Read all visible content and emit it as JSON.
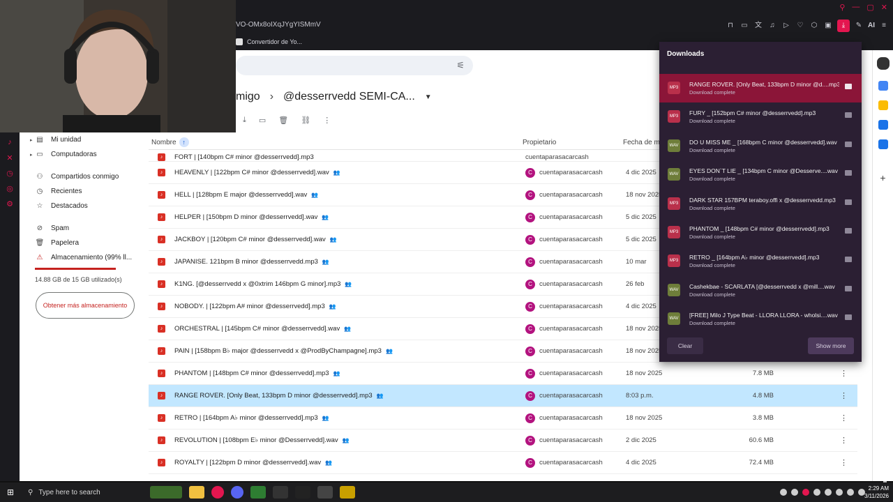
{
  "browser": {
    "address_text": "VO-OMx8oIXqJYgYISMmV",
    "tab_label": "Convertidor de Yo...",
    "ai_label": "AI"
  },
  "drive": {
    "breadcrumb": {
      "parent": "migo",
      "current": "@desserrvedd SEMI-CA..."
    },
    "sidebar": {
      "items": [
        {
          "label": "Mi unidad",
          "icon": "drive-icon"
        },
        {
          "label": "Computadoras",
          "icon": "computer-icon"
        },
        {
          "label": "Compartidos conmigo",
          "icon": "people-icon"
        },
        {
          "label": "Recientes",
          "icon": "clock-icon"
        },
        {
          "label": "Destacados",
          "icon": "star-icon"
        },
        {
          "label": "Spam",
          "icon": "spam-icon"
        },
        {
          "label": "Papelera",
          "icon": "trash-icon"
        },
        {
          "label": "Almacenamiento (99% ll...",
          "icon": "warning-icon"
        }
      ],
      "storage_text": "14.88 GB de 15 GB utilizado(s)",
      "storage_percent": 99,
      "get_storage_label": "Obtener más almacenamiento"
    },
    "columns": {
      "name": "Nombre",
      "owner": "Propietario",
      "date": "Fecha de m"
    },
    "partial_row": {
      "name": "FORT | [140bpm C# minor @desserrvedd].mp3",
      "owner": "cuentaparasacarcash"
    },
    "files": [
      {
        "name": "HEAVENLY | [122bpm C# minor @desserrvedd].wav",
        "owner": "cuentaparasacarcash",
        "date": "4 dic 2025",
        "size": ""
      },
      {
        "name": "HELL | [128bpm E major @desserrvedd].wav",
        "owner": "cuentaparasacarcash",
        "date": "18 nov 2025",
        "size": ""
      },
      {
        "name": "HELPER | [150bpm D minor @desserrvedd].wav",
        "owner": "cuentaparasacarcash",
        "date": "5 dic 2025",
        "size": ""
      },
      {
        "name": "JACKBOY | [120bpm C# minor @desserrvedd].wav",
        "owner": "cuentaparasacarcash",
        "date": "5 dic 2025",
        "size": ""
      },
      {
        "name": "JAPANISE. 121bpm B minor @desserrvedd.mp3",
        "owner": "cuentaparasacarcash",
        "date": "10 mar",
        "size": ""
      },
      {
        "name": "K1NG.  [@desserrvedd x @0xtrim 146bpm G minor].mp3",
        "owner": "cuentaparasacarcash",
        "date": "26 feb",
        "size": ""
      },
      {
        "name": "NOBODY. | [122bpm A# minor @desserrvedd].mp3",
        "owner": "cuentaparasacarcash",
        "date": "4 dic 2025",
        "size": ""
      },
      {
        "name": "ORCHESTRAL | [145bpm C# minor @desserrvedd].wav",
        "owner": "cuentaparasacarcash",
        "date": "18 nov 2025",
        "size": ""
      },
      {
        "name": "PAIN | [158bpm B♭ major @desserrvedd x @ProdByChampagne].mp3",
        "owner": "cuentaparasacarcash",
        "date": "18 nov 2025",
        "size": ""
      },
      {
        "name": "PHANTOM | [148bpm C# minor @desserrvedd].mp3",
        "owner": "cuentaparasacarcash",
        "date": "18 nov 2025",
        "size": "7.8 MB"
      },
      {
        "name": "RANGE ROVER. [Only Beat, 133bpm D minor @desserrvedd].mp3",
        "owner": "cuentaparasacarcash",
        "date": "8:03 p.m.",
        "size": "4.8 MB",
        "selected": true
      },
      {
        "name": "RETRO | [164bpm A♭ minor @desserrvedd].mp3",
        "owner": "cuentaparasacarcash",
        "date": "18 nov 2025",
        "size": "3.8 MB"
      },
      {
        "name": "REVOLUTION | [108bpm E♭ minor @Desserrvedd].wav",
        "owner": "cuentaparasacarcash",
        "date": "2 dic 2025",
        "size": "60.6 MB"
      },
      {
        "name": "ROYALTY | [122bpm D minor @desserrvedd].wav",
        "owner": "cuentaparasacarcash",
        "date": "4 dic 2025",
        "size": "72.4 MB"
      }
    ]
  },
  "downloads": {
    "title": "Downloads",
    "items": [
      {
        "name": "RANGE ROVER. [Only Beat, 133bpm D minor @d....mp3",
        "status": "Download complete",
        "type": "mp3",
        "highlight": true
      },
      {
        "name": "FURY _ [152bpm C# minor @desserrvedd].mp3",
        "status": "Download complete",
        "type": "mp3"
      },
      {
        "name": "DO U MISS ME _ [168bpm C minor @desserrvedd].wav",
        "status": "Download complete",
        "type": "wav"
      },
      {
        "name": "EYES DON`T LIE _ [134bpm C minor @Desserve....wav",
        "status": "Download complete",
        "type": "wav"
      },
      {
        "name": "DARK STAR 157BPM teraboy.offi x @desserrvedd.mp3",
        "status": "Download complete",
        "type": "mp3"
      },
      {
        "name": "PHANTOM _ [148bpm C# minor @desserrvedd].mp3",
        "status": "Download complete",
        "type": "mp3"
      },
      {
        "name": "RETRO _ [164bpm A♭ minor @desserrvedd].mp3",
        "status": "Download complete",
        "type": "mp3"
      },
      {
        "name": "Cashekbae - SCARLATA [@desserrvedd x @mill....wav",
        "status": "Download complete",
        "type": "wav"
      },
      {
        "name": "[FREE] Milo J Type Beat - LLORA LLORA - wholsi....wav",
        "status": "Download complete",
        "type": "wav"
      }
    ],
    "clear_label": "Clear",
    "show_more_label": "Show more"
  },
  "taskbar": {
    "search_placeholder": "Type here to search",
    "time": "2:29 AM",
    "date": "3/11/2026"
  },
  "colors": {
    "accent": "#e3164f",
    "selected_row": "#c2e7ff",
    "panel_bg": "#2b1f33"
  }
}
